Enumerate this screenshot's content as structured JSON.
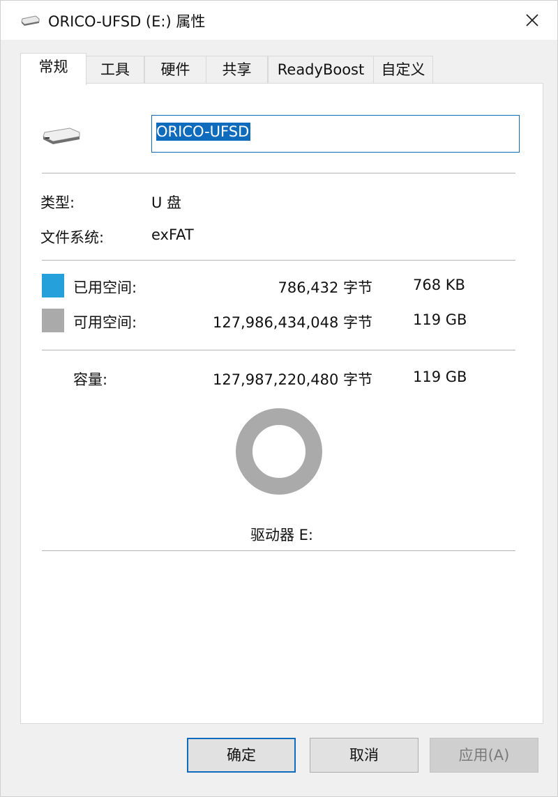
{
  "window": {
    "title": "ORICO-UFSD (E:) 属性",
    "icon": "drive-icon",
    "close_icon": "close-icon"
  },
  "tabs": [
    {
      "label": "常规",
      "active": true
    },
    {
      "label": "工具"
    },
    {
      "label": "硬件"
    },
    {
      "label": "共享"
    },
    {
      "label": "ReadyBoost"
    },
    {
      "label": "自定义"
    }
  ],
  "general": {
    "drive_name_value": "ORICO-UFSD",
    "type_label": "类型:",
    "type_value": "U 盘",
    "fs_label": "文件系统:",
    "fs_value": "exFAT",
    "used_label": "已用空间:",
    "used_bytes": "786,432 字节",
    "used_size": "768 KB",
    "used_color": "#26a0da",
    "free_label": "可用空间:",
    "free_bytes": "127,986,434,048 字节",
    "free_size": "119 GB",
    "free_color": "#aaaaaa",
    "capacity_label": "容量:",
    "capacity_bytes": "127,987,220,480 字节",
    "capacity_size": "119 GB",
    "used_fraction": 6.1e-06,
    "drive_label": "驱动器 E:"
  },
  "buttons": {
    "ok": "确定",
    "cancel": "取消",
    "apply": "应用(A)"
  }
}
